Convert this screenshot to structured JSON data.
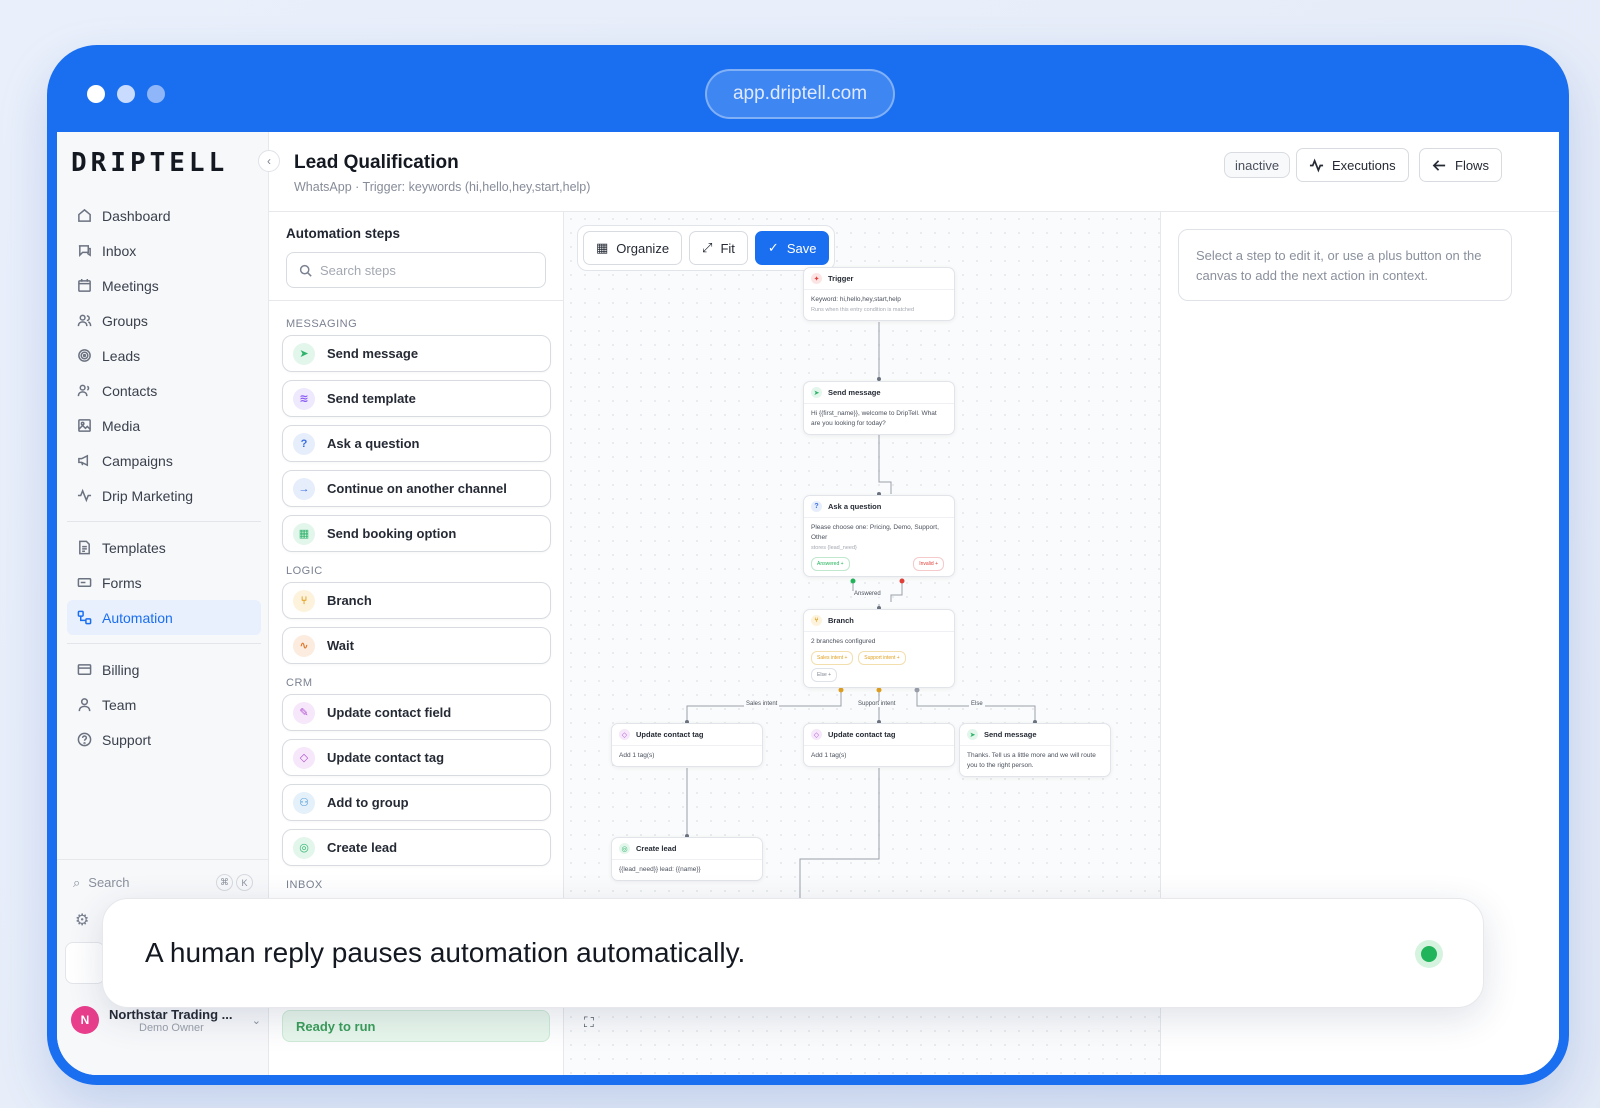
{
  "browser": {
    "url": "app.driptell.com",
    "dot_colors": [
      "#ffffff",
      "#c9dcff",
      "#8fb6f8"
    ]
  },
  "sidebar": {
    "logo": "DRIPTELL",
    "items": [
      {
        "label": "Dashboard",
        "icon": "home-icon"
      },
      {
        "label": "Inbox",
        "icon": "inbox-icon"
      },
      {
        "label": "Meetings",
        "icon": "calendar-icon"
      },
      {
        "label": "Groups",
        "icon": "users-icon"
      },
      {
        "label": "Leads",
        "icon": "target-icon"
      },
      {
        "label": "Contacts",
        "icon": "contacts-icon"
      },
      {
        "label": "Media",
        "icon": "image-icon"
      },
      {
        "label": "Campaigns",
        "icon": "megaphone-icon"
      },
      {
        "label": "Drip Marketing",
        "icon": "activity-icon"
      },
      {
        "label": "Templates",
        "icon": "file-icon"
      },
      {
        "label": "Forms",
        "icon": "form-icon"
      },
      {
        "label": "Automation",
        "icon": "workflow-icon"
      },
      {
        "label": "Billing",
        "icon": "card-icon"
      },
      {
        "label": "Team",
        "icon": "user-icon"
      },
      {
        "label": "Support",
        "icon": "help-icon"
      }
    ],
    "active": "Automation",
    "search_label": "Search",
    "shortcut": [
      "⌘",
      "K"
    ],
    "account_name": "Northstar Trading ...",
    "account_role": "Demo Owner",
    "avatar_letter": "N"
  },
  "header": {
    "title": "Lead Qualification",
    "subtitle": "WhatsApp · Trigger: keywords (hi,hello,hey,start,help)",
    "status": "inactive",
    "executions_label": "Executions",
    "flows_label": "Flows"
  },
  "steps_panel": {
    "title": "Automation steps",
    "search_placeholder": "Search steps",
    "categories": [
      {
        "name": "MESSAGING",
        "steps": [
          {
            "label": "Send message",
            "color": "#2fb36b",
            "bg": "#e3f6eb",
            "glyph": "➤"
          },
          {
            "label": "Send template",
            "color": "#8b5cf6",
            "bg": "#efe9fd",
            "glyph": "≋"
          },
          {
            "label": "Ask a question",
            "color": "#3b6fe0",
            "bg": "#e6edfb",
            "glyph": "?"
          },
          {
            "label": "Continue on another channel",
            "color": "#3b6fe0",
            "bg": "#e6edfb",
            "glyph": "→"
          },
          {
            "label": "Send booking option",
            "color": "#2fb36b",
            "bg": "#e3f6eb",
            "glyph": "▦"
          }
        ]
      },
      {
        "name": "LOGIC",
        "steps": [
          {
            "label": "Branch",
            "color": "#e0a020",
            "bg": "#fdf3dd",
            "glyph": "⑂"
          },
          {
            "label": "Wait",
            "color": "#e07a30",
            "bg": "#fcecdf",
            "glyph": "∿"
          }
        ]
      },
      {
        "name": "CRM",
        "steps": [
          {
            "label": "Update contact field",
            "color": "#b04fd0",
            "bg": "#f6e7fb",
            "glyph": "✎"
          },
          {
            "label": "Update contact tag",
            "color": "#b04fd0",
            "bg": "#f6e7fb",
            "glyph": "◇"
          },
          {
            "label": "Add to group",
            "color": "#3b8fd0",
            "bg": "#e4f0fa",
            "glyph": "⚇"
          },
          {
            "label": "Create lead",
            "color": "#2fb36b",
            "bg": "#e3f6eb",
            "glyph": "◎"
          }
        ]
      },
      {
        "name": "INBOX",
        "steps": []
      }
    ],
    "ready_label": "Ready to run"
  },
  "canvas": {
    "toolbar": {
      "organize": "Organize",
      "fit": "Fit",
      "save": "Save"
    },
    "nodes": {
      "trigger": {
        "title": "Trigger",
        "body": "Keyword: hi,hello,hey,start,help",
        "sub": "Runs when this entry condition is matched"
      },
      "send1": {
        "title": "Send message",
        "body": "Hi {{first_name}}, welcome to DripTell. What are you looking for today?"
      },
      "ask": {
        "title": "Ask a question",
        "body": "Please choose one: Pricing, Demo, Support, Other",
        "sub": "stores {lead_need}",
        "tag_ok": "Answered +",
        "tag_bad": "Invalid +"
      },
      "branch": {
        "title": "Branch",
        "body": "2 branches configured",
        "tags": [
          "Sales intent +",
          "Support intent +",
          "Else +"
        ]
      },
      "tag1": {
        "title": "Update contact tag",
        "body": "Add 1 tag(s)"
      },
      "tag2": {
        "title": "Update contact tag",
        "body": "Add 1 tag(s)"
      },
      "send2": {
        "title": "Send message",
        "body": "Thanks. Tell us a little more and we will route you to the right person."
      },
      "lead": {
        "title": "Create lead",
        "body": "{{lead_need}} lead: {{name}}"
      }
    },
    "edge_labels": {
      "answered": "Answered",
      "sales": "Sales intent",
      "support": "Support intent",
      "else": "Else"
    }
  },
  "right_panel": {
    "hint": "Select a step to edit it, or use a plus button on the canvas to add the next action in context."
  },
  "toast": {
    "message": "A human reply pauses automation automatically.",
    "indicator_color": "#22b45a"
  }
}
